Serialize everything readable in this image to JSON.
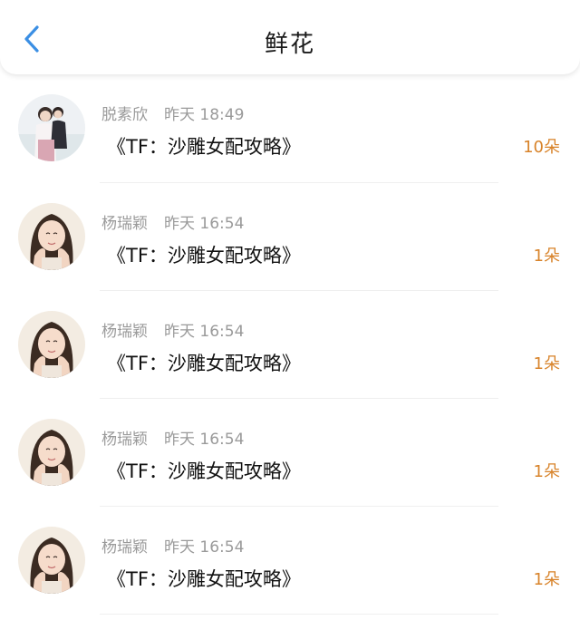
{
  "header": {
    "title": "鲜花"
  },
  "colors": {
    "accent_blue": "#3b8fe4",
    "count_orange": "#d8832a"
  },
  "items": [
    {
      "name": "脱素欣",
      "time": "昨天 18:49",
      "book": "《TF：沙雕女配攻略》",
      "count": "10朵",
      "avatar": "avatar-couple-photo"
    },
    {
      "name": "杨瑞颖",
      "time": "昨天 16:54",
      "book": "《TF：沙雕女配攻略》",
      "count": "1朵",
      "avatar": "avatar-girl-photo"
    },
    {
      "name": "杨瑞颖",
      "time": "昨天 16:54",
      "book": "《TF：沙雕女配攻略》",
      "count": "1朵",
      "avatar": "avatar-girl-photo"
    },
    {
      "name": "杨瑞颖",
      "time": "昨天 16:54",
      "book": "《TF：沙雕女配攻略》",
      "count": "1朵",
      "avatar": "avatar-girl-photo"
    },
    {
      "name": "杨瑞颖",
      "time": "昨天 16:54",
      "book": "《TF：沙雕女配攻略》",
      "count": "1朵",
      "avatar": "avatar-girl-photo"
    }
  ]
}
